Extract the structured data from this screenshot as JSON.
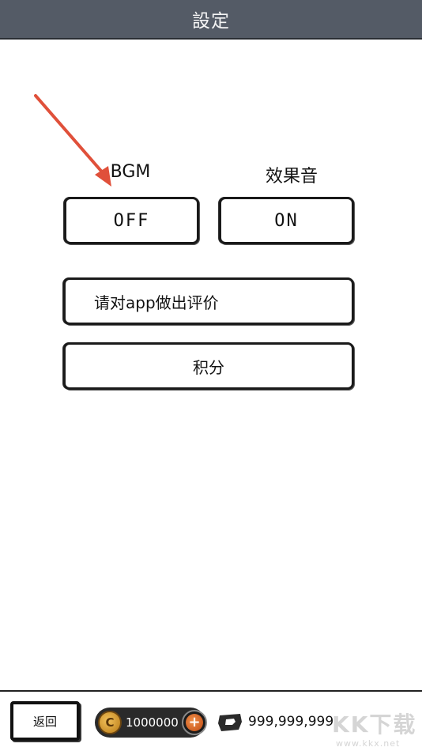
{
  "header": {
    "title": "設定"
  },
  "settings": {
    "bgm_label": "BGM",
    "bgm_state": "OFF",
    "se_label": "效果音",
    "se_state": "ON",
    "rate_label": "请对app做出评价",
    "score_label": "积分"
  },
  "footer": {
    "back_label": "返回",
    "coins": "1000000",
    "tickets": "999,999,999"
  },
  "icons": [
    "arrow-icon",
    "coin-icon",
    "plus-icon",
    "ticket-icon"
  ],
  "colors": {
    "header_bg": "#545b66",
    "arrow": "#e0503a",
    "coin": "#d9a030",
    "plus": "#e06a2a"
  },
  "watermark": {
    "main": "KK下载",
    "sub": "www.kkx.net"
  }
}
